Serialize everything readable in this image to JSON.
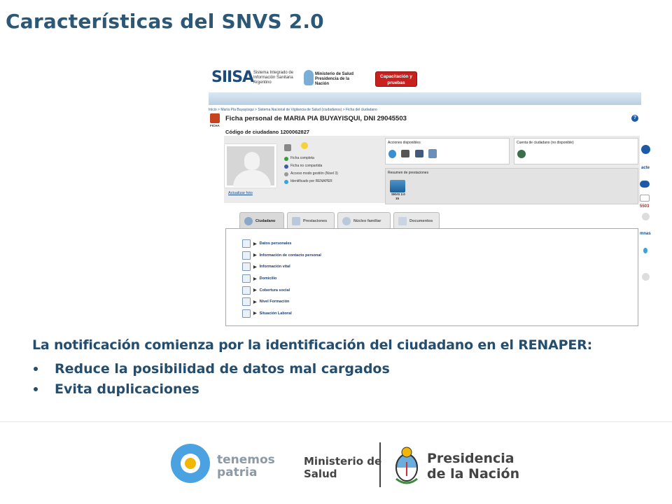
{
  "slide": {
    "title": "Características del SNVS 2.0",
    "main_text": "La notificación comienza por la identificación del ciudadano en el RENAPER:",
    "bullets": [
      "Reduce la posibilidad de datos mal cargados",
      "Evita duplicaciones"
    ]
  },
  "screenshot": {
    "logo": "SIISA",
    "logo_sub": "Sistema Integrado de Información Sanitaria Argentino",
    "ministerio": "Ministerio de Salud Presidencia de la Nación",
    "capacitacion_button": "Capacitación y pruebas",
    "breadcrumb": "Inicio > María Pía Buyayisqui > Sistema Nacional de Vigilancia de Salud (ciudadanos) > Ficha del ciudadano",
    "ficha_label": "FICHA",
    "ficha_title": "Ficha personal de MARIA PIA BUYAYISQUI, DNI 29045503",
    "codigo": "Código de ciudadano 1200062827",
    "actualizar_foto": "Actualizar foto",
    "status_items": [
      "Ficha completa",
      "Ficha no compartida",
      "Acceso modo gestión (Nivel 3)",
      "Identificado por RENAPER"
    ],
    "acciones_title": "Acciones disponibles",
    "cuenta_title": "Cuenta de ciudadano (no disponible)",
    "resumen_title": "Resumen de prestaciones",
    "snvs_tile_label": "SNVS 2.0",
    "snvs_tile_count": "15",
    "tabs": [
      "Ciudadano",
      "Prestaciones",
      "Núcleo familiar",
      "Documentos"
    ],
    "sections": [
      "Datos personales",
      "Información de contacto personal",
      "Información vital",
      "Domicilio",
      "Cobertura social",
      "Nivel Formación",
      "Situación Laboral"
    ],
    "right_strip": [
      "acte",
      "5503",
      "mnas"
    ]
  },
  "footer": {
    "tenemos": "tenemos",
    "patria": "patria",
    "ministerio": "Ministerio de",
    "salud": "Salud",
    "presidencia": "Presidencia",
    "nacion": "de la Nación"
  },
  "colors": {
    "title": "#2c5877",
    "text": "#244d6e",
    "capacitacion": "#c9201f",
    "tp_blue": "#4aa3e0"
  }
}
